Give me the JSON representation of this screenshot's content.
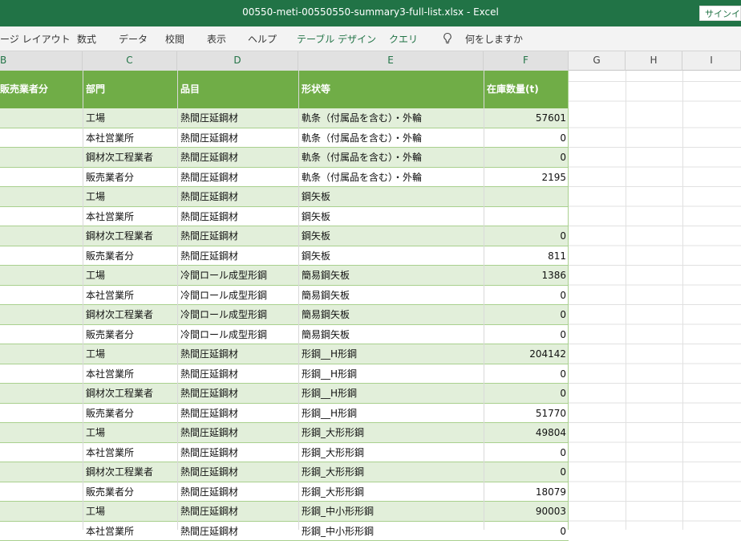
{
  "window": {
    "title": "00550-meti-00550550-summary3-full-list.xlsx  -  Excel",
    "signin": "サインイン"
  },
  "ribbon": {
    "tabs": [
      "ージ レイアウト",
      "数式",
      "データ",
      "校閲",
      "表示",
      "ヘルプ",
      "テーブル デザイン",
      "クエリ"
    ],
    "tell_me": "何をしますか",
    "tell_me_icon": "lightbulb-icon"
  },
  "columns": [
    "B",
    "C",
    "D",
    "E",
    "F",
    "G",
    "H",
    "I"
  ],
  "table": {
    "headers": [
      "販売業者分",
      "部門",
      "品目",
      "形状等",
      "在庫数量(t)"
    ],
    "rows": [
      [
        "",
        "工場",
        "熱間圧延鋼材",
        "軌条（付属品を含む）・外輪",
        "57601"
      ],
      [
        "",
        "本社営業所",
        "熱間圧延鋼材",
        "軌条（付属品を含む）・外輪",
        "0"
      ],
      [
        "",
        "鋼材次工程業者",
        "熱間圧延鋼材",
        "軌条（付属品を含む）・外輪",
        "0"
      ],
      [
        "",
        "販売業者分",
        "熱間圧延鋼材",
        "軌条（付属品を含む）・外輪",
        "2195"
      ],
      [
        "",
        "工場",
        "熱間圧延鋼材",
        "鋼矢板",
        ""
      ],
      [
        "",
        "本社営業所",
        "熱間圧延鋼材",
        "鋼矢板",
        ""
      ],
      [
        "",
        "鋼材次工程業者",
        "熱間圧延鋼材",
        "鋼矢板",
        "0"
      ],
      [
        "",
        "販売業者分",
        "熱間圧延鋼材",
        "鋼矢板",
        "811"
      ],
      [
        "",
        "工場",
        "冷間ロール成型形鋼",
        "簡易鋼矢板",
        "1386"
      ],
      [
        "",
        "本社営業所",
        "冷間ロール成型形鋼",
        "簡易鋼矢板",
        "0"
      ],
      [
        "",
        "鋼材次工程業者",
        "冷間ロール成型形鋼",
        "簡易鋼矢板",
        "0"
      ],
      [
        "",
        "販売業者分",
        "冷間ロール成型形鋼",
        "簡易鋼矢板",
        "0"
      ],
      [
        "",
        "工場",
        "熱間圧延鋼材",
        "形鋼__H形鋼",
        "204142"
      ],
      [
        "",
        "本社営業所",
        "熱間圧延鋼材",
        "形鋼__H形鋼",
        "0"
      ],
      [
        "",
        "鋼材次工程業者",
        "熱間圧延鋼材",
        "形鋼__H形鋼",
        "0"
      ],
      [
        "",
        "販売業者分",
        "熱間圧延鋼材",
        "形鋼__H形鋼",
        "51770"
      ],
      [
        "",
        "工場",
        "熱間圧延鋼材",
        "形鋼_大形形鋼",
        "49804"
      ],
      [
        "",
        "本社営業所",
        "熱間圧延鋼材",
        "形鋼_大形形鋼",
        "0"
      ],
      [
        "",
        "鋼材次工程業者",
        "熱間圧延鋼材",
        "形鋼_大形形鋼",
        "0"
      ],
      [
        "",
        "販売業者分",
        "熱間圧延鋼材",
        "形鋼_大形形鋼",
        "18079"
      ],
      [
        "",
        "工場",
        "熱間圧延鋼材",
        "形鋼_中小形形鋼",
        "90003"
      ],
      [
        "",
        "本社営業所",
        "熱間圧延鋼材",
        "形鋼_中小形形鋼",
        "0"
      ]
    ]
  },
  "colors": {
    "titlebar": "#217346",
    "table_header": "#70ad47",
    "band": "#e2efda"
  }
}
